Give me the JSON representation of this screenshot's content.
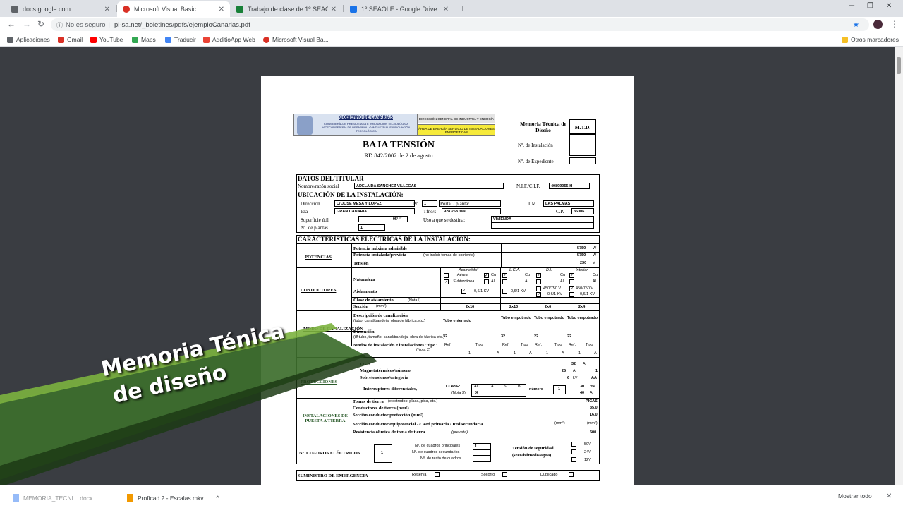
{
  "browser": {
    "tabs": [
      {
        "label": "docs.google.com",
        "color": "#5f6368",
        "active": false
      },
      {
        "label": "Microsoft Visual Basic",
        "color": "#d93025",
        "active": true
      },
      {
        "label": "Trabajo de clase de 1º SEAOLE",
        "color": "#188038",
        "active": false
      },
      {
        "label": "1º SEAOLE - Google Drive",
        "color": "#1a73e8",
        "active": false
      }
    ],
    "security_label": "No es seguro",
    "url": "pi-sa.net/_boletines/pdfs/ejemploCanarias.pdf",
    "bookmarks": [
      {
        "label": "Aplicaciones",
        "color": "#5f6368"
      },
      {
        "label": "Gmail",
        "color": "#d93025"
      },
      {
        "label": "YouTube",
        "color": "#ff0000"
      },
      {
        "label": "Maps",
        "color": "#34a853"
      },
      {
        "label": "Traducir",
        "color": "#4285f4"
      },
      {
        "label": "AdditioApp Web",
        "color": "#ea4335"
      },
      {
        "label": "Microsoft Visual Ba...",
        "color": "#d93025"
      }
    ],
    "other_bookmarks": "Otros marcadores"
  },
  "document": {
    "gobierno": "GOBIERNO DE CANARIAS",
    "consejeria": "CONSEJERÍA DE PRESIDENCIA E INNOVACIÓN TECNOLÓGICA VICECONSEJERÍA DE DESARROLLO INDUSTRIAL E INNOVACIÓN TECNOLÓGICA",
    "direccion_general": "DIRECCIÓN GENERAL DE INDUSTRIA Y ENERGÍA",
    "area": "ÁREA DE ENERGÍA SERVICIO DE INSTALACIONES ENERGÉTICAS",
    "memoria": "Memoria Técnica de Diseño",
    "mtd": "M.T.D.",
    "n_instalacion": "Nº. de Instalación",
    "n_expediente": "Nº. de Expediente",
    "title": "BAJA TENSIÓN",
    "subtitle": "RD 842/2002 de 2 de agosto",
    "titular_header": "DATOS DEL TITULAR",
    "nombre_label": "Nombre/razón social",
    "nombre_value": "ADELAIDA SANCHEZ VILLEGAS",
    "nif_label": "N.I.F./C.I.F.",
    "nif_value": "40899055-H",
    "ubicacion_header": "UBICACIÓN DE LA INSTALACIÓN:",
    "direccion_label": "Dirección",
    "direccion_value": "C/ JOSE MESA Y LOPEZ",
    "numero_label": "Nº.",
    "numero_value": "1",
    "portal_label": "Portal / planta:",
    "tm_label": "T.M.",
    "tm_value": "LAS PALMAS",
    "isla_label": "Isla",
    "isla_value": "GRAN CANARIA",
    "tfno_label": "Tfno/s",
    "tfno_value": "928 258 369",
    "cp_label": "C.P.",
    "cp_value": "35006",
    "superficie_label": "Superficie útil",
    "superficie_value": "95",
    "superficie_unit": "m²",
    "uso_label": "Uso a que se destina:",
    "uso_value": "VIVIENDA",
    "plantas_label": "Nº. de plantas",
    "plantas_value": "1",
    "caract_header": "CARACTERÍSTICAS ELÉCTRICAS DE LA INSTALACIÓN:",
    "potencias_label": "POTENCIAS",
    "pot_max_label": "Potencia máxima admisible",
    "pot_max_value": "5750",
    "pot_inst_label": "Potencia instalada/prevista",
    "pot_inst_note": "(no incluir tomas de corriente)",
    "pot_inst_value": "5750",
    "tension_label": "Tensión",
    "tension_value": "230",
    "unit_w": "W",
    "unit_v": "V",
    "conductores_label": "CONDUCTORES",
    "acometida": "Acometida*",
    "lga": "L.G.A.",
    "di": "D.I.",
    "interior": "Interior",
    "naturaleza": "Naturaleza",
    "aerea": "Aérea",
    "subterranea": "Subterránea",
    "cu": "Cu",
    "al": "Al",
    "aislamiento": "Aislamiento",
    "kv06": "0,6/1 KV",
    "v450": "450/750 V",
    "clase_aislamiento": "Clase de aislamiento",
    "nota1": "(Nota1)",
    "seccion": "Sección",
    "mm2": "(mm²)",
    "secciones": [
      "2x16",
      "2x10",
      "2x6",
      "2x4"
    ],
    "modo_label": "MODO DE CANALIZACIÓN",
    "descripcion": "Descripción de canalización",
    "descripcion_note": "(tubo, canal/bandeja, obra de fábrica,etc.)",
    "canalizaciones": [
      "Tubo enterrado",
      "Tubo empotrado",
      "Tubo empotrado",
      "Tubo empotrado"
    ],
    "dimension": "Dimensión",
    "dimension_note": "(Ø tubo, tamaño, canal/bandeja, obra de fábrica etc.)",
    "dimensiones": [
      "32",
      "32",
      "22",
      "22"
    ],
    "modos": "Modos de instalación e instalaciones \"tipo\"",
    "nota2": "(Nota 2)",
    "ref": "Ref.",
    "tipo": "Tipo",
    "ref_values": [
      "1",
      "1",
      "1",
      "1"
    ],
    "tipo_values": [
      "A",
      "A",
      "A",
      "A"
    ],
    "protecciones_label": "PROTECCIONES",
    "prot_lga": "I.G.A.",
    "prot_lga_value": "32",
    "magnetotermicos": "Magnetotérmicos/número",
    "magnet_value": "25",
    "magnet_count": "1",
    "sobretensiones": "Sobretensiones/categoría",
    "sobre_value": "6",
    "sobre_unit": "kV",
    "sobre_cat": "AA",
    "interruptores": "Interruptores diferenciales,",
    "clase_label": "CLASE:",
    "nota3": "(Nota 3)",
    "clases": [
      "AC",
      "A",
      "S",
      "B"
    ],
    "clase_x": "X",
    "numero_label2": "número",
    "numero_value2": "1",
    "dif_values": [
      "30",
      "40"
    ],
    "unit_ma": "mA",
    "unit_a": "A",
    "puesta_label": "INSTALACIONES DE PUESTA A TIERRA",
    "tomas_tierra": "Tomas de tierra",
    "tomas_note": "(electrodos: placa, pica, etc.)",
    "tomas_value": "PICAS",
    "cond_tierra": "Conductores de tierra (mm²)",
    "cond_value": "35,0",
    "seccion_prot": "Sección conductor protección (mm²)",
    "seccion_prot_value": "16,0",
    "seccion_equip": "Sección conductor equipotencial -> Red primaria / Red secundaria",
    "resistencia": "Resistencia óhmica de toma de tierra",
    "prevista": "(prevista)",
    "resistencia_value": "500",
    "cuadros_label": "Nº. CUADROS ELÉCTRICOS",
    "cuadros_value": "1",
    "cuadros_principales": "Nº. de cuadros principales",
    "cuadros_principales_value": "1",
    "cuadros_secundarios": "Nº. de cuadros secundarios",
    "cuadros_resto": "Nº. de resto de cuadros",
    "tension_seg": "Tensión de seguridad",
    "tension_seg_note": "(seco/húmedo/agua)",
    "volts": [
      "50V",
      "24V",
      "12V"
    ],
    "emergencia": "SUMINISTRO DE EMERGENCIA",
    "reserva": "Reserva",
    "socorro": "Socorro",
    "duplicado": "Duplicado"
  },
  "overlay": {
    "line1": "Memoria Ténica",
    "line2": "de diseño"
  },
  "downloads": {
    "items": [
      "MEMORIA_TECNI....docx",
      "Proficad 2 - Escalas.mkv"
    ],
    "show_all": "Mostrar todo"
  }
}
